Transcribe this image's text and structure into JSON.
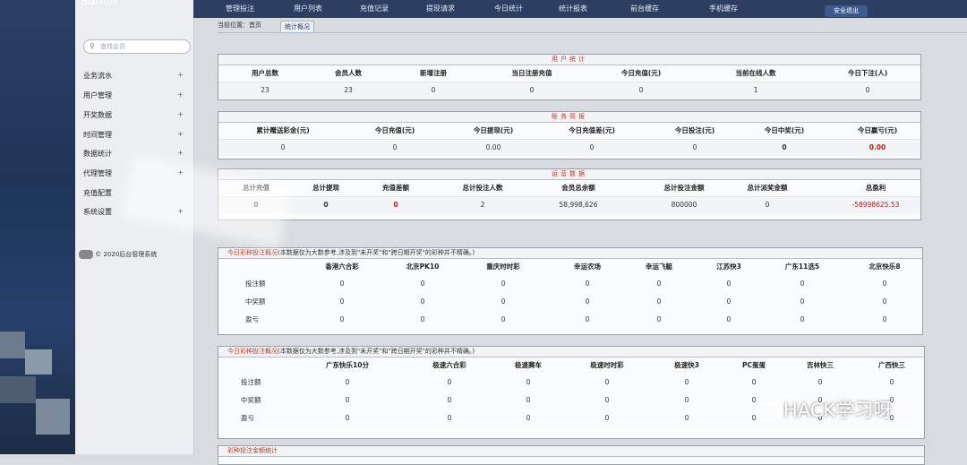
{
  "app": {
    "user": "admin",
    "logout_label": "安全退出",
    "footer": "© 2020后台管理系统"
  },
  "nav": [
    "管理投注",
    "用户列表",
    "充值记录",
    "提现请求",
    "今日统计",
    "统计报表",
    "前台缓存",
    "手机缓存"
  ],
  "search": {
    "placeholder": "查找会员"
  },
  "sidebar": [
    {
      "label": "业务流水"
    },
    {
      "label": "用户管理"
    },
    {
      "label": "开奖数据"
    },
    {
      "label": "时间管理"
    },
    {
      "label": "数据统计"
    },
    {
      "label": "代理管理"
    },
    {
      "label": "充值配置"
    },
    {
      "label": "系统设置"
    }
  ],
  "breadcrumb": {
    "prefix": "当前位置：",
    "home": "首页",
    "current": "统计概况"
  },
  "user_stats": {
    "title": "用户统计",
    "headers": [
      "用户总数",
      "会员人数",
      "新增注册",
      "当日注册充值",
      "今日充值(元)",
      "当前在线人数",
      "今日下注(人)"
    ],
    "values": [
      "23",
      "23",
      "0",
      "0",
      "0",
      "1",
      "0"
    ]
  },
  "finance": {
    "title": "账务简报",
    "headers": [
      "累计赠送彩金(元)",
      "今日充值(元)",
      "今日提现(元)",
      "今日充值差(元)",
      "今日投注(元)",
      "今日中奖(元)",
      "今日赢亏(元)"
    ],
    "values": [
      "0",
      "0",
      "0.00",
      "0",
      "0",
      "0",
      "0.00"
    ]
  },
  "operations": {
    "title": "运营数据",
    "headers": [
      "总计充值",
      "总计提现",
      "充值差额",
      "总计投注人数",
      "会员总余额",
      "总计投注金额",
      "总计派奖金额",
      "总盈利"
    ],
    "values": [
      "0",
      "0",
      "0",
      "2",
      "58,998,626",
      "800000",
      "0",
      "-58998625.53"
    ]
  },
  "lottery1": {
    "title": "今日彩种投注概况",
    "note": "(本数据仅为大数参考,涉及到\"未开奖\"和\"跨日期开奖\"的彩种并不精确。)",
    "columns": [
      "香港六合彩",
      "北京PK10",
      "重庆时时彩",
      "幸运农场",
      "幸运飞艇",
      "江苏快3",
      "广东11选5",
      "北京快乐8"
    ],
    "rows": [
      {
        "label": "投注额",
        "values": [
          "0",
          "0",
          "0",
          "0",
          "0",
          "0",
          "0",
          "0"
        ]
      },
      {
        "label": "中奖额",
        "values": [
          "0",
          "0",
          "0",
          "0",
          "0",
          "0",
          "0",
          "0"
        ]
      },
      {
        "label": "盈亏",
        "values": [
          "0",
          "0",
          "0",
          "0",
          "0",
          "0",
          "0",
          "0"
        ]
      }
    ]
  },
  "lottery2": {
    "title": "今日彩种投注概况",
    "note": "(本数据仅为大数参考,涉及到\"未开奖\"和\"跨日期开奖\"的彩种并不精确。)",
    "columns": [
      "广东快乐10分",
      "极速六合彩",
      "极速赛车",
      "极速时时彩",
      "极速快3",
      "PC蛋蛋",
      "吉林快三",
      "广西快三"
    ],
    "rows": [
      {
        "label": "投注额",
        "values": [
          "0",
          "0",
          "0",
          "0",
          "0",
          "0",
          "0",
          "0"
        ]
      },
      {
        "label": "中奖额",
        "values": [
          "0",
          "0",
          "0",
          "0",
          "0",
          "0",
          "0",
          "0"
        ]
      },
      {
        "label": "盈亏",
        "values": [
          "0",
          "0",
          "0",
          "0",
          "0",
          "0",
          "0",
          "0"
        ]
      }
    ]
  },
  "bottom_panel": {
    "title": "彩种投注金额统计"
  },
  "watermark": {
    "text": "HACK学习呀"
  }
}
